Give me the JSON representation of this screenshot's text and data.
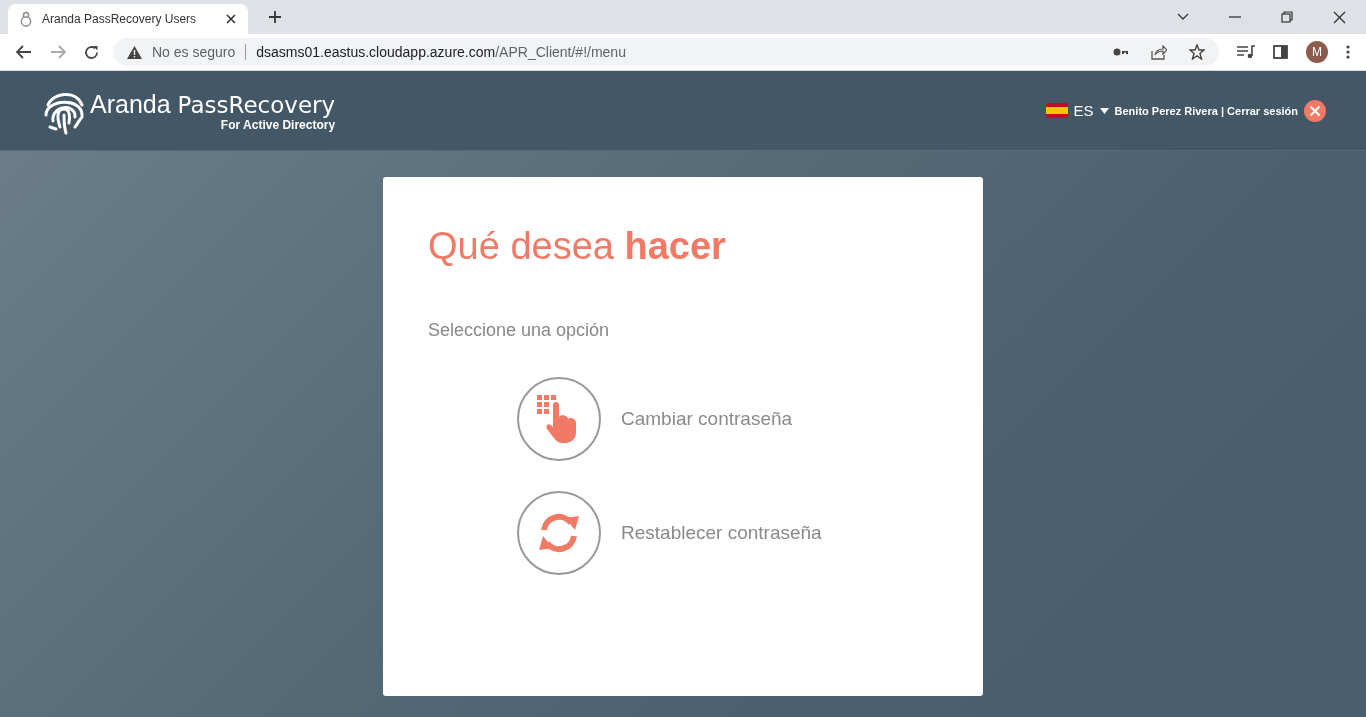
{
  "browser": {
    "tab_title": "Aranda PassRecovery Users",
    "security": "No es seguro",
    "url_host": "dsasms01.eastus.cloudapp.azure.com",
    "url_path": "/APR_Client/#!/menu",
    "avatar": "M"
  },
  "header": {
    "logo_name": "Aranda",
    "logo_product": "PassRecovery",
    "logo_sub": "For Active Directory",
    "language": "ES",
    "user": "Benito Perez Rivera | Cerrar sesión"
  },
  "card": {
    "title": "Qué desea **hacer**",
    "subtitle": "Seleccione una opción",
    "options": [
      {
        "kind": "keypad",
        "label": "Cambiar contraseña"
      },
      {
        "kind": "refresh",
        "label": "Restablecer contraseña"
      }
    ]
  }
}
